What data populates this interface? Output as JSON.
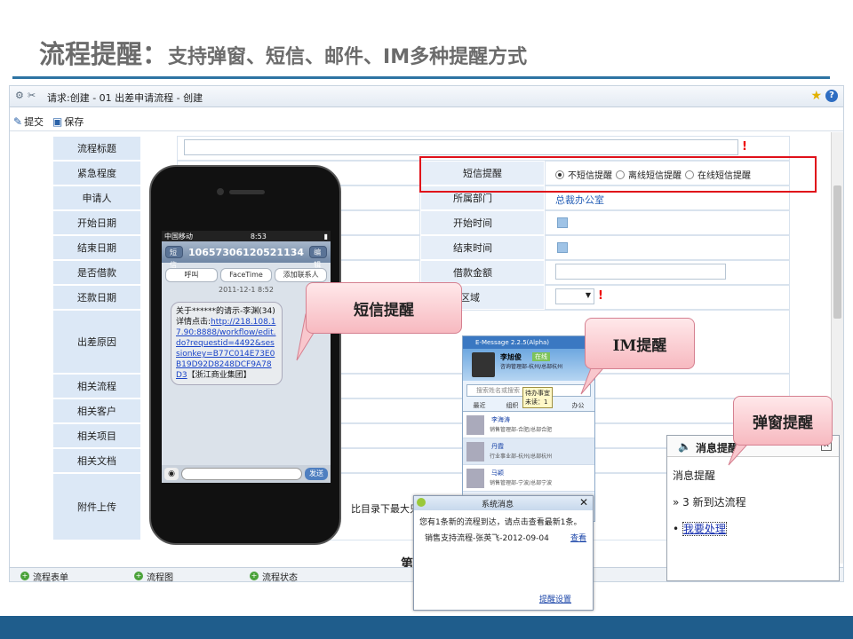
{
  "slide": {
    "title_main": "流程提醒：",
    "title_sub": "支持弹窗、短信、邮件、IM多种提醒方式"
  },
  "window": {
    "title": "请求:创建 - 01 出差申请流程 - 创建",
    "help": "?"
  },
  "toolbar": {
    "submit": "提交",
    "save": "保存"
  },
  "form": {
    "flow_title": "流程标题",
    "urgency": "紧急程度",
    "applicant": "申请人",
    "start_date": "开始日期",
    "end_date": "结束日期",
    "borrow": "是否借款",
    "repay_date": "还款日期",
    "reason": "出差原因",
    "related_flow": "相关流程",
    "related_customer": "相关客户",
    "related_project": "相关项目",
    "related_doc": "相关文档",
    "attachment": "附件上传",
    "attachment_hint": "比目录下最大只能",
    "sms_label": "短信提醒",
    "sms_opt1": "不短信提醒",
    "sms_opt2": "离线短信提醒",
    "sms_opt3": "在线短信提醒",
    "dept_label": "所属部门",
    "dept_value": "总裁办公室",
    "start_time": "开始时间",
    "end_time": "结束时间",
    "loan_amount": "借款金额",
    "trip_area": "出差区域",
    "required_mark": "!",
    "cut_text": "第"
  },
  "bottom_tabs": [
    "流程表单",
    "流程图",
    "流程状态"
  ],
  "phone": {
    "carrier": "中国移动",
    "time": "8:53",
    "back": "短信",
    "number": "10657306120521134",
    "edit": "编辑",
    "call": "呼叫",
    "facetime": "FaceTime",
    "add_contact": "添加联系人",
    "date": "2011-12-1 8:52",
    "sms_text": "关于******的请示-李渊(34)详情点击:",
    "sms_link": "http://218.108.17.90:8888/workflow/edit.do?requestid=4492&sessionkey=B77C014E73E0B19D92D8248DCF9A78D3",
    "sms_tail": "【浙江商业集团】",
    "send": "发送"
  },
  "callouts": {
    "sms": "短信提醒",
    "im": "IM提醒",
    "popup": "弹窗提醒"
  },
  "im": {
    "title": "E-Message 2.2.5(Alpha)",
    "name": "李旭俊",
    "status": "在线",
    "dept": "咨询管理部-杭州/总部杭州",
    "search": "搜索姓名或搜索",
    "tabs": [
      "最近",
      "组织",
      "分组",
      "办公"
    ],
    "contacts": [
      {
        "name": "李海涛",
        "dept": "销售管理部-合肥/总部合肥"
      },
      {
        "name": "丹霞",
        "dept": "行业事业部-杭州/总部杭州"
      },
      {
        "name": "马颖",
        "dept": "销售管理部-宁波/总部宁波"
      }
    ],
    "tip_title": "待办事宜",
    "tip_count": "未读：1"
  },
  "sysmsg": {
    "title": "系统消息",
    "text": "您有1条新的流程到达，请点击查看最新1条。",
    "item": "销售支持流程-张英飞-2012-09-04",
    "view": "查看",
    "settings": "提醒设置"
  },
  "popup": {
    "title": "消息提醒",
    "line1": "消息提醒",
    "line2": "» 3 新到达流程",
    "link": "我要处理"
  }
}
